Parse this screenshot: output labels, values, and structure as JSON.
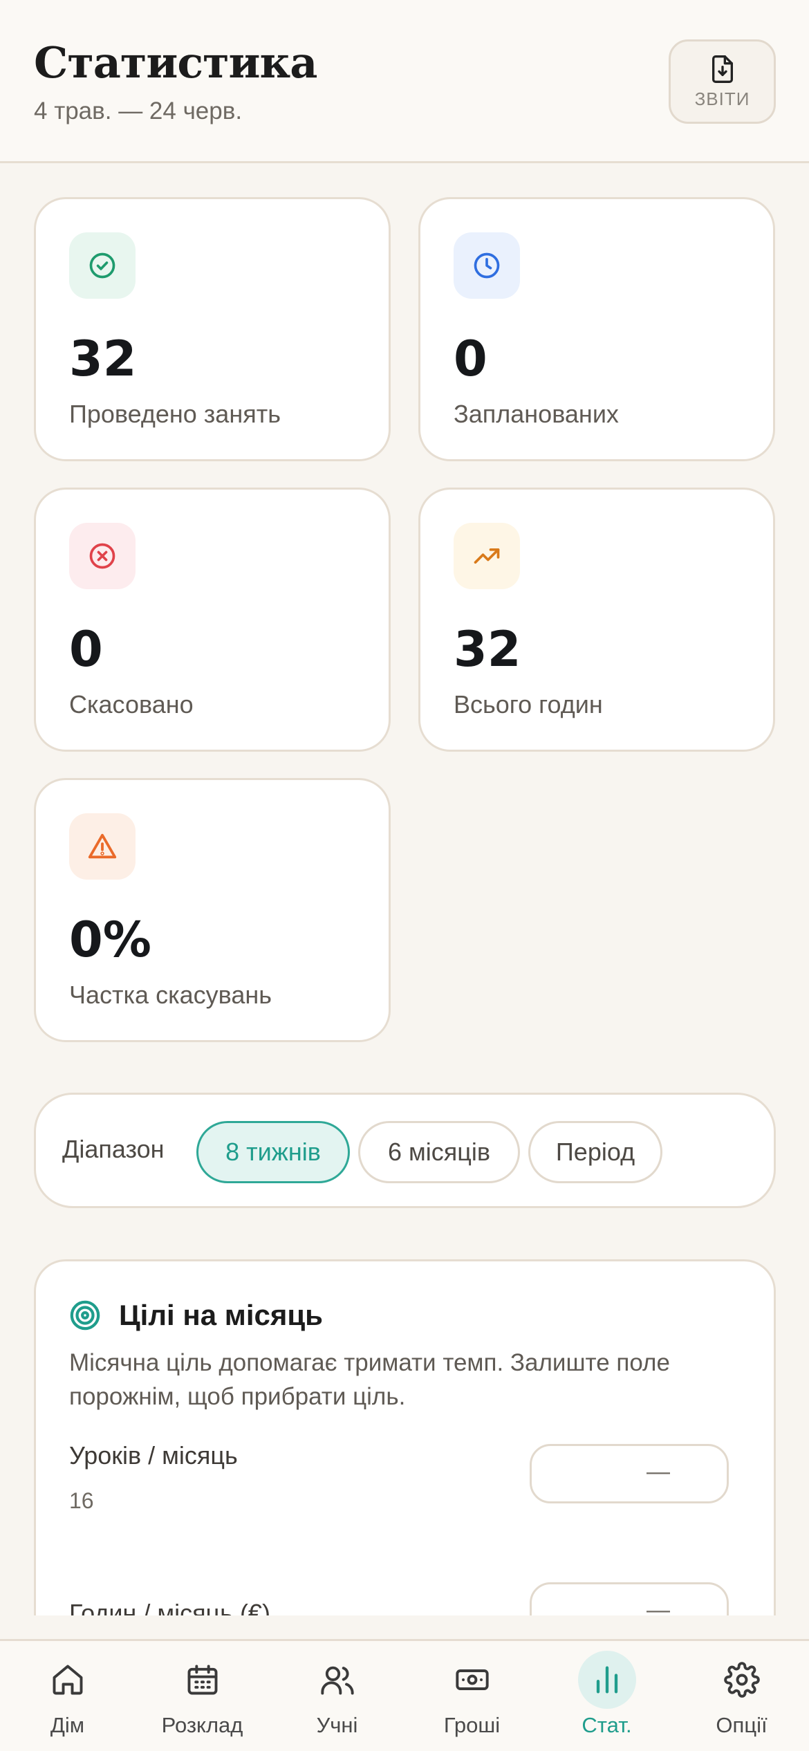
{
  "header": {
    "title": "Статистика",
    "subtitle": "4 трав. — 24 черв.",
    "reports_label": "ЗВІТИ"
  },
  "stats": [
    {
      "value": "32",
      "label": "Проведено занять",
      "icon": "check-circle-icon",
      "color": "#1e9b6d",
      "bg": "#e8f6ef"
    },
    {
      "value": "0",
      "label": "Запланованих",
      "icon": "clock-icon",
      "color": "#2f6ee0",
      "bg": "#eaf1fd"
    },
    {
      "value": "0",
      "label": "Скасовано",
      "icon": "x-circle-icon",
      "color": "#e0424a",
      "bg": "#fdecee"
    },
    {
      "value": "32",
      "label": "Всього годин",
      "icon": "trending-up-icon",
      "color": "#d97a1a",
      "bg": "#fef6e6"
    },
    {
      "value": "0%",
      "label": "Частка скасувань",
      "icon": "warning-icon",
      "color": "#ea6a2a",
      "bg": "#fdefe6"
    }
  ],
  "range": {
    "label": "Діапазон",
    "options": [
      "8 тижнів",
      "6 місяців",
      "Період"
    ],
    "selected": "8 тижнів"
  },
  "goals": {
    "title": "Цілі на місяць",
    "description": "Місячна ціль допомагає тримати темп. Залиште поле порожнім, щоб прибрати ціль.",
    "items": [
      {
        "label": "Уроків / місяць",
        "value": "16",
        "input": "—"
      },
      {
        "label": "Годин / місяць (€)",
        "input": "—"
      }
    ]
  },
  "nav": {
    "items": [
      "Дім",
      "Розклад",
      "Учні",
      "Гроші",
      "Стат.",
      "Опції"
    ],
    "active": "Стат."
  },
  "colors": {
    "accent": "#1f9d8c",
    "background": "#f8f5f0",
    "card_border": "#e6ddd1"
  }
}
